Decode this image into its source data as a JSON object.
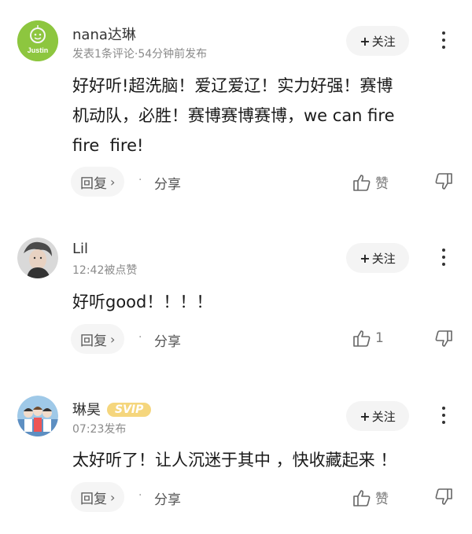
{
  "comments": [
    {
      "username": "nana达琳",
      "meta": "发表1条评论·54分钟前发布",
      "avatar_text": "Justin",
      "follow_label": "关注",
      "content": "好好听!超洗脑！爱辽爱辽！实力好强！赛博\n机动队，必胜！赛博赛博赛博，we can fire\nfire  fire!",
      "reply_label": "回复",
      "share_label": "分享",
      "like_label": "赞",
      "badge": ""
    },
    {
      "username": "Lil",
      "meta": "12:42被点赞",
      "avatar_text": "",
      "follow_label": "关注",
      "content": "好听good！！！！",
      "reply_label": "回复",
      "share_label": "分享",
      "like_label": "1",
      "badge": ""
    },
    {
      "username": "琳昊",
      "meta": "07:23发布",
      "avatar_text": "",
      "follow_label": "关注",
      "content": "太好听了！让人沉迷于其中 ，快收藏起来 ！",
      "reply_label": "回复",
      "share_label": "分享",
      "like_label": "赞",
      "badge": "SVIP"
    }
  ],
  "colors": {
    "svip_badge": "#f5d67d",
    "follow_bg": "#f4f4f4",
    "avatar1_bg": "#8dc63f"
  },
  "icons": [
    "plus-icon",
    "more-vertical-icon",
    "chevron-right-icon",
    "thumbs-up-icon",
    "thumbs-down-icon"
  ]
}
